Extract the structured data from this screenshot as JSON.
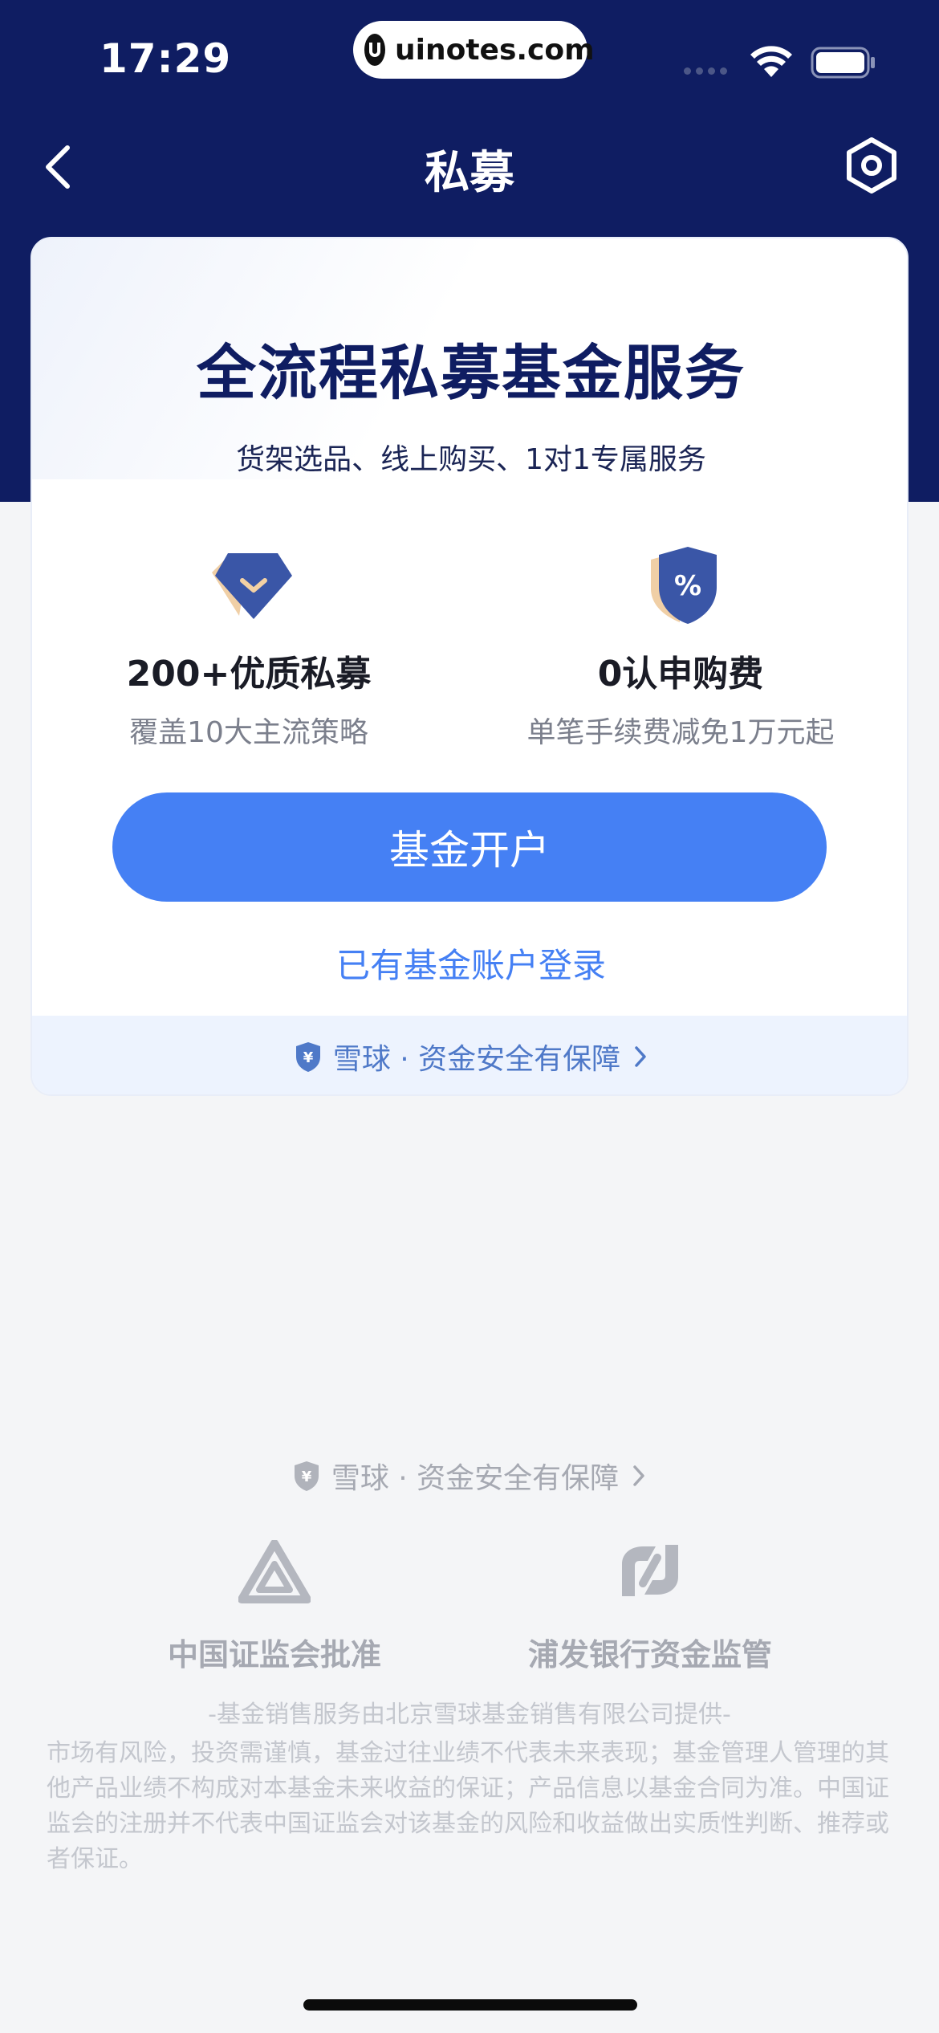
{
  "status_bar": {
    "time": "17:29",
    "url": "uinotes.com"
  },
  "nav": {
    "title": "私募",
    "back_icon": "chevron-left-icon",
    "settings_icon": "settings-hexagon-icon"
  },
  "hero": {
    "title": "全流程私募基金服务",
    "subtitle": "货架选品、线上购买、1对1专属服务"
  },
  "features": [
    {
      "icon": "gem-down-icon",
      "title": "200+优质私募",
      "desc": "覆盖10大主流策略"
    },
    {
      "icon": "percent-shield-icon",
      "title": "0认申购费",
      "desc": "单笔手续费减免1万元起"
    }
  ],
  "actions": {
    "open_account": "基金开户",
    "login": "已有基金账户登录"
  },
  "safety": {
    "text": "雪球 · 资金安全有保障",
    "icon": "yuan-shield-icon"
  },
  "footer": {
    "safety_text": "雪球 · 资金安全有保障",
    "badges": [
      {
        "icon": "csrc-logo-icon",
        "label": "中国证监会批准"
      },
      {
        "icon": "spdb-logo-icon",
        "label": "浦发银行资金监管"
      }
    ],
    "provider": "-基金销售服务由北京雪球基金销售有限公司提供-",
    "disclaimer": "市场有风险，投资需谨慎，基金过往业绩不代表未来表现；基金管理人管理的其他产品业绩不构成对本基金未来收益的保证；产品信息以基金合同为准。中国证监会的注册并不代表中国证监会对该基金的风险和收益做出实质性判断、推荐或者保证。"
  },
  "colors": {
    "header_bg": "#0f1d62",
    "primary": "#4580f4",
    "title": "#0f1d62"
  }
}
